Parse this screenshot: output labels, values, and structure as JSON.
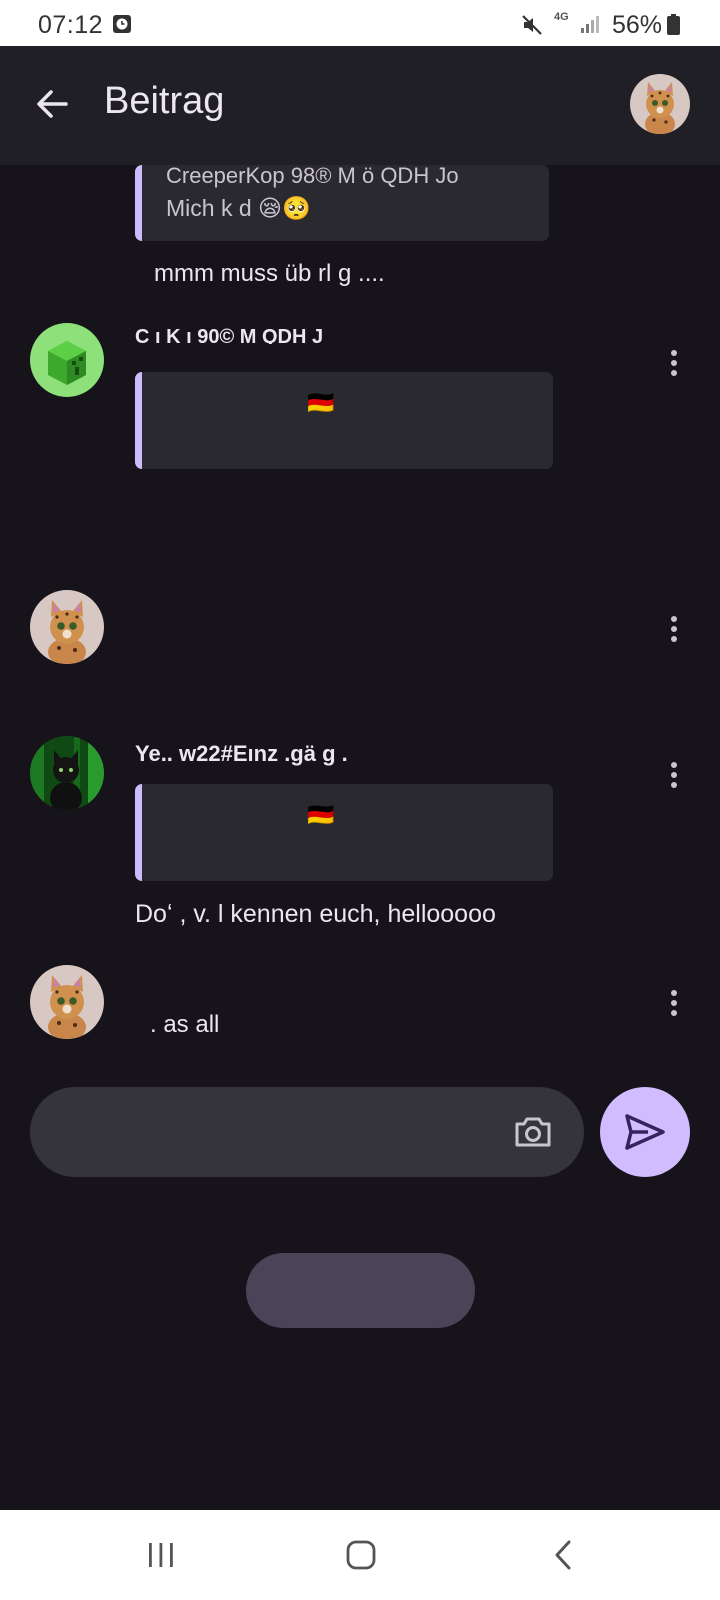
{
  "status_bar": {
    "time": "07:12",
    "network": "4G",
    "battery": "56%"
  },
  "app_bar": {
    "title": "Beitrag"
  },
  "posts": [
    {
      "quote_line1": "CreeperKop 98® M ö QDH Jo",
      "quote_line2": "Mich k d 😪🥺",
      "text": "mmm muss üb rl g ...."
    },
    {
      "username": "C ı K ı 90© M QDH J",
      "quote": "🇩🇪"
    },
    {
      "username": ""
    },
    {
      "username": "Ye.. w22#Eınz .gä g .",
      "quote": "🇩🇪",
      "text": "Doʻ , v. l kennen euch, hellooooo"
    },
    {
      "text": ". as all"
    }
  ],
  "composer": {
    "placeholder": ""
  },
  "colors": {
    "background": "#16141a",
    "surface": "#211f26",
    "quote_bg": "#2b2930",
    "accent": "#cfbcff",
    "send": "#d0bcff"
  },
  "icons": [
    "clock-icon",
    "mute-icon",
    "signal-icon",
    "battery-icon",
    "back-arrow-icon",
    "more-vert-icon",
    "camera-icon",
    "send-icon",
    "recents-icon",
    "home-icon",
    "back-nav-icon"
  ]
}
